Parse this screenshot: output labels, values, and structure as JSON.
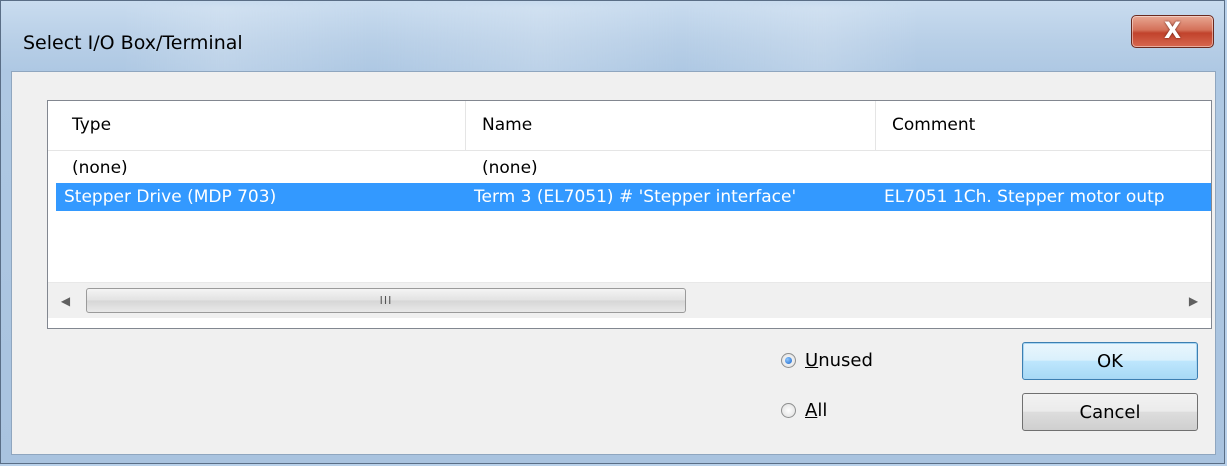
{
  "window": {
    "title": "Select I/O Box/Terminal",
    "close_glyph": "X",
    "accent": "#3399ff"
  },
  "list": {
    "columns": [
      "Type",
      "Name",
      "Comment"
    ],
    "rows": [
      {
        "type": "(none)",
        "name": "(none)",
        "comment": ""
      },
      {
        "type": "Stepper Drive (MDP 703)",
        "name": "Term 3 (EL7051) # 'Stepper interface'",
        "comment": "EL7051 1Ch. Stepper motor outp"
      }
    ],
    "selected_index": 1
  },
  "scrollbar": {
    "left_icon": "chevron-left-icon",
    "right_icon": "chevron-right-icon",
    "grip": "III"
  },
  "filter": {
    "unused_label_accel": "U",
    "unused_label_rest": "nused",
    "all_label_accel": "A",
    "all_label_rest": "ll",
    "selected": "unused"
  },
  "buttons": {
    "ok": "OK",
    "cancel": "Cancel"
  }
}
